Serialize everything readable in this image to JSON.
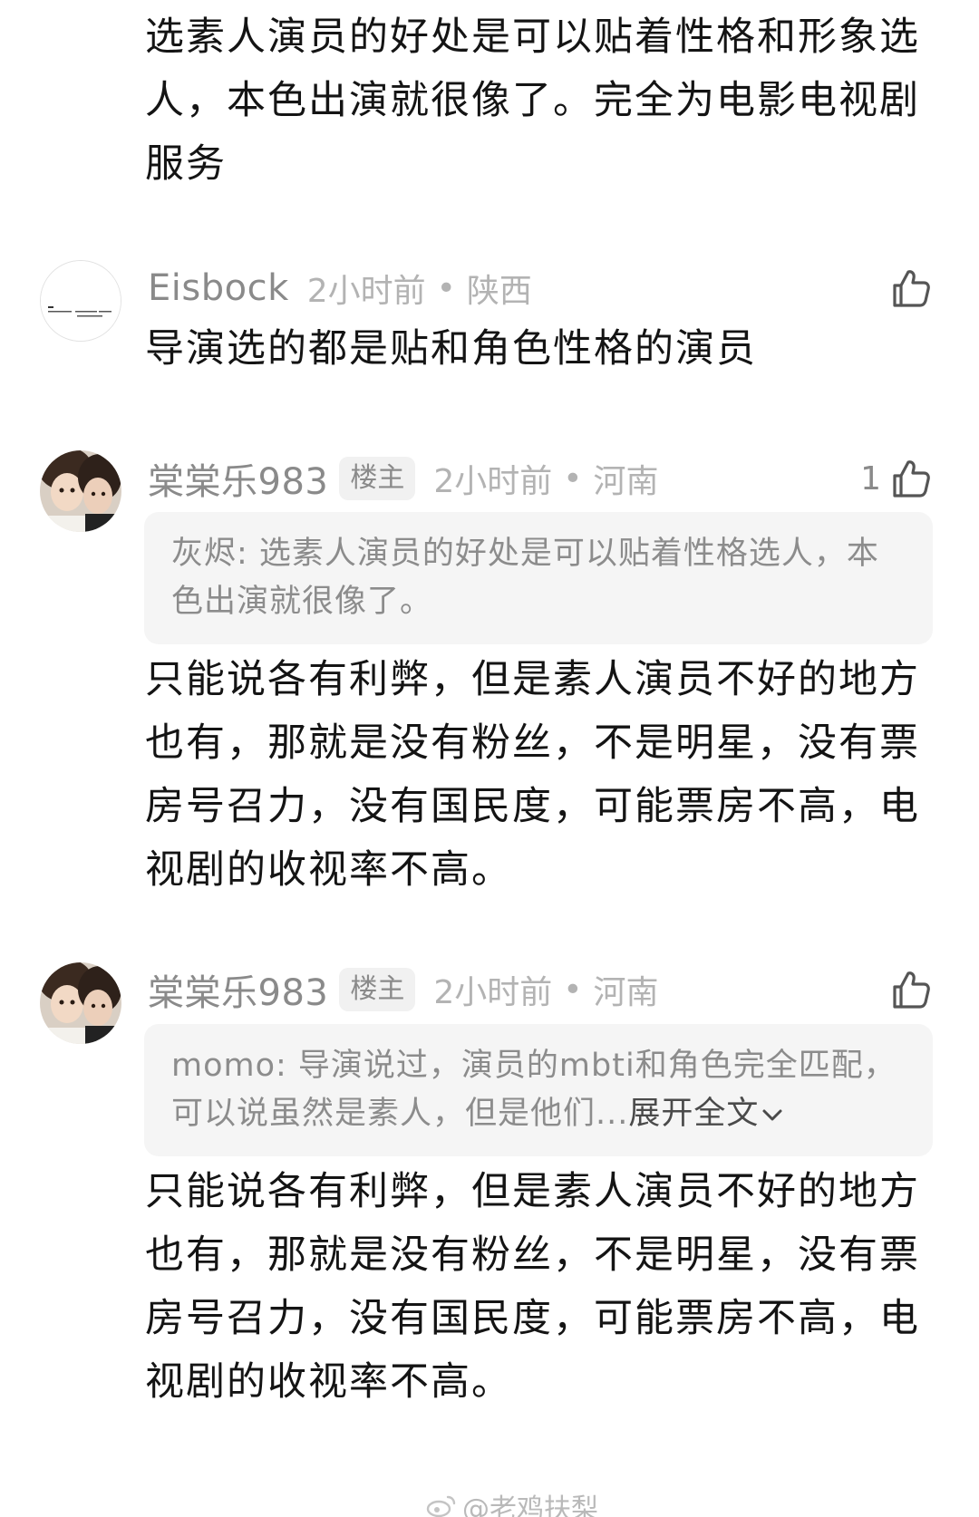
{
  "top_comment_text": "选素人演员的好处是可以贴着性格和形象选人，本色出演就很像了。完全为电影电视剧服务",
  "comments": [
    {
      "username": "Eisbock",
      "time": "2小时前",
      "dot": "•",
      "region": "陕西",
      "text": "导演选的都是贴和角色性格的演员"
    },
    {
      "username": "棠棠乐983",
      "badge": "楼主",
      "time": "2小时前",
      "dot": "•",
      "region": "河南",
      "like_count": "1",
      "quote": "灰烬: 选素人演员的好处是可以贴着性格选人，本色出演就很像了。",
      "text": "只能说各有利弊，但是素人演员不好的地方也有，那就是没有粉丝，不是明星，没有票房号召力，没有国民度，可能票房不高，电视剧的收视率不高。"
    },
    {
      "username": "棠棠乐983",
      "badge": "楼主",
      "time": "2小时前",
      "dot": "•",
      "region": "河南",
      "quote": "momo: 导演说过，演员的mbti和角色完全匹配，可以说虽然是素人，但是他们...",
      "quote_expand": "展开全文",
      "text": "只能说各有利弊，但是素人演员不好的地方也有，那就是没有粉丝，不是明星，没有票房号召力，没有国民度，可能票房不高，电视剧的收视率不高。"
    }
  ],
  "watermark": "@老鸡扶梨",
  "icons": {
    "like": "thumbs-up-icon",
    "expand": "chevron-down-icon",
    "watermark": "weibo-logo-icon"
  },
  "colors": {
    "text": "#141414",
    "meta": "#8a8a8a",
    "meta_light": "#b3b3b3",
    "quote_bg": "#f5f5f5"
  }
}
